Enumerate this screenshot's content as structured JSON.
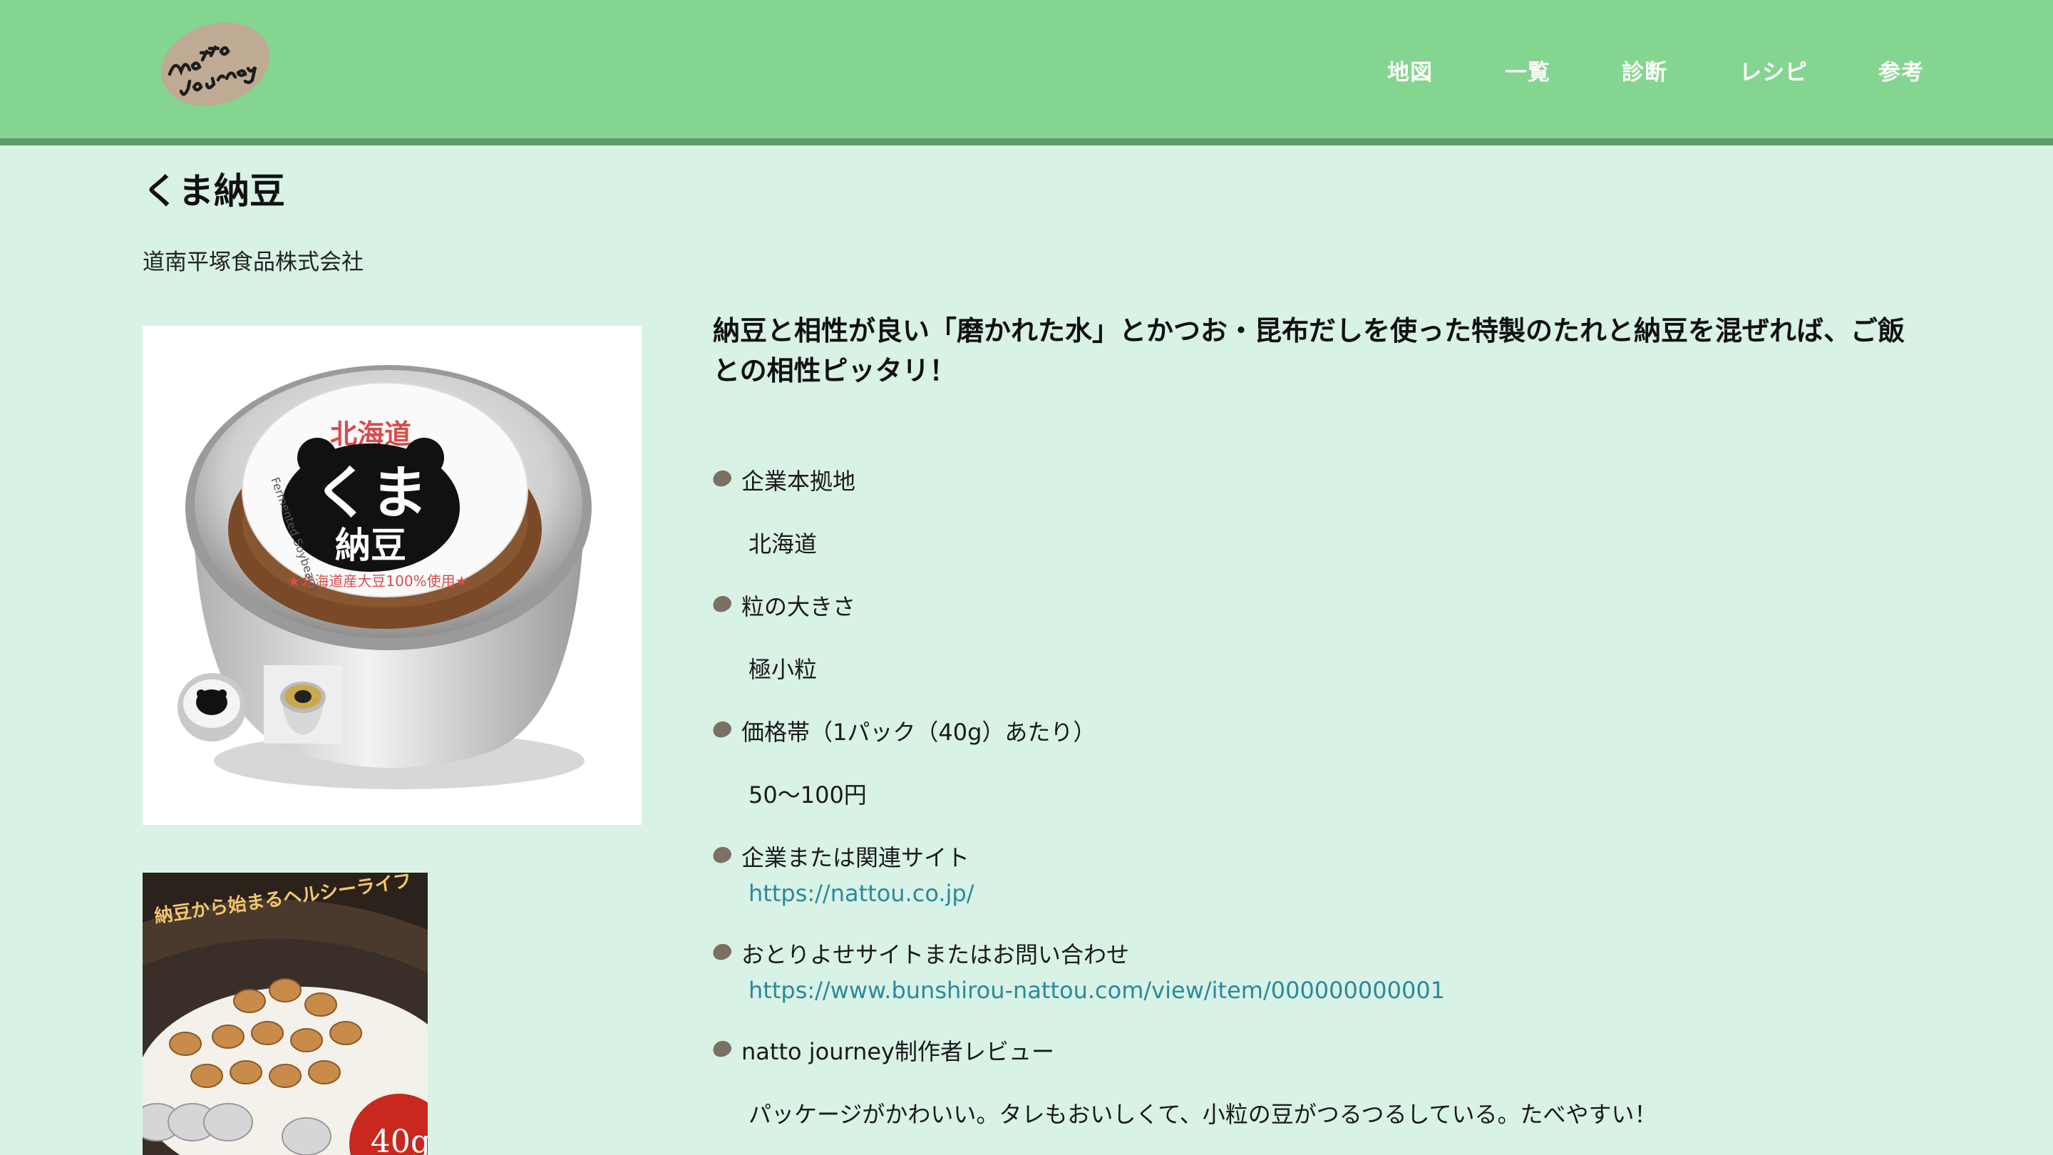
{
  "header": {
    "logo_text": "natto journey",
    "nav": [
      "地図",
      "一覧",
      "診断",
      "レシピ",
      "参考"
    ]
  },
  "product": {
    "title": "くま納豆",
    "company": "道南平塚食品株式会社",
    "lead": "納豆と相性が良い「磨かれた水」とかつお・昆布だしを使った特製のたれと納豆を混ぜれば、ご飯との相性ピッタリ！",
    "package_text": {
      "region": "北海道",
      "name_top": "くま",
      "name_bottom": "納豆",
      "side": "Fermented Soybeans",
      "bottom": "★北海道産大豆100%使用★"
    },
    "promo_text": {
      "banner": "納豆から始まるヘルシーライフ",
      "weight": "40g"
    }
  },
  "specs": [
    {
      "label": "企業本拠地",
      "value": "北海道"
    },
    {
      "label": "粒の大きさ",
      "value": "極小粒"
    },
    {
      "label": "価格帯（1パック（40g）あたり）",
      "value": "50〜100円"
    },
    {
      "label": "企業または関連サイト",
      "link": "https://nattou.co.jp/"
    },
    {
      "label": "おとりよせサイトまたはお問い合わせ",
      "link": "https://www.bunshirou-nattou.com/view/item/000000000001"
    },
    {
      "label": "natto journey制作者レビュー",
      "value": "パッケージがかわいい。タレもおいしくて、小粒の豆がつるつるしている。たべやすい！"
    }
  ],
  "colors": {
    "header_bg": "#84d590",
    "header_border": "#5e9d69",
    "page_bg": "#d9f2e6",
    "link": "#2a8a9a",
    "bullet": "#7a7063"
  }
}
